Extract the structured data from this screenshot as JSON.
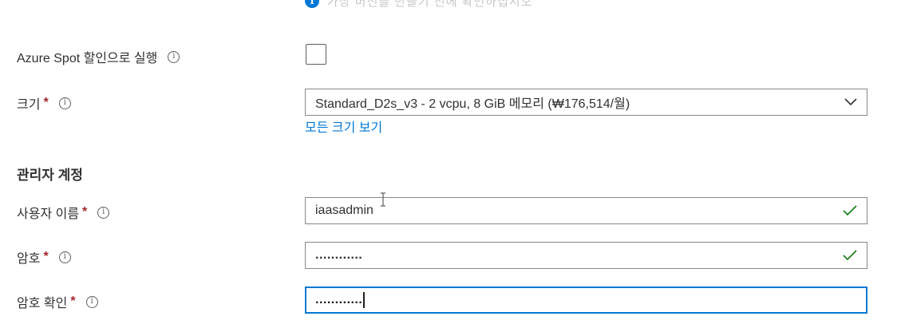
{
  "info_banner": {
    "text": "가상 머신을 만들기 전에 확인하십시오"
  },
  "spot": {
    "label": "Azure Spot 할인으로 실행",
    "checked": false
  },
  "size": {
    "label": "크기",
    "required_mark": "*",
    "selected": "Standard_D2s_v3 - 2 vcpu, 8 GiB 메모리 (₩176,514/월)",
    "see_all_link": "모든 크기 보기"
  },
  "admin_section": {
    "title": "관리자 계정"
  },
  "username": {
    "label": "사용자 이름",
    "required_mark": "*",
    "value": "iaasadmin",
    "valid": true
  },
  "password": {
    "label": "암호",
    "required_mark": "*",
    "value": "............",
    "valid": true
  },
  "confirm_password": {
    "label": "암호 확인",
    "required_mark": "*",
    "value": "............"
  },
  "colors": {
    "accent": "#0078d4",
    "valid_check": "#107c10",
    "required": "#a4262c"
  }
}
